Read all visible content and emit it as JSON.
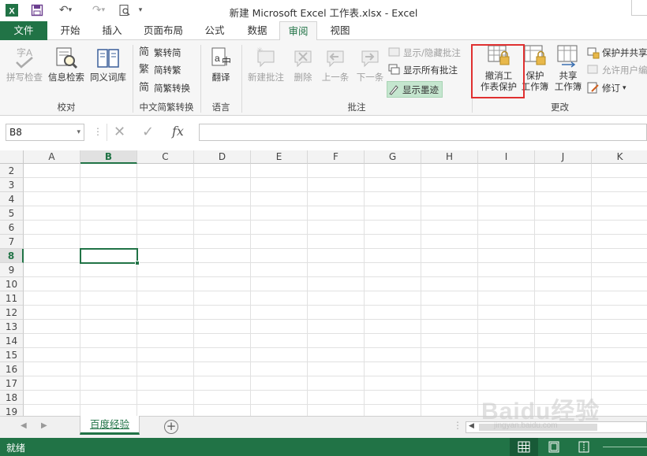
{
  "window": {
    "title": "新建 Microsoft Excel 工作表.xlsx - Excel"
  },
  "tabs": [
    "文件",
    "开始",
    "插入",
    "页面布局",
    "公式",
    "数据",
    "审阅",
    "视图"
  ],
  "active_tab": "审阅",
  "ribbon": {
    "proofing": {
      "group": "校对",
      "spell": "拼写检查",
      "research": "信息检索",
      "thesaurus": "同义词库"
    },
    "chinese": {
      "group": "中文简繁转换",
      "to_simplified": "繁转简",
      "to_traditional": "简转繁",
      "convert": "简繁转换"
    },
    "language": {
      "group": "语言",
      "translate": "翻译"
    },
    "comments": {
      "group": "批注",
      "new": "新建批注",
      "delete": "删除",
      "prev": "上一条",
      "next": "下一条",
      "show_hide": "显示/隐藏批注",
      "show_all": "显示所有批注",
      "show_ink": "显示墨迹"
    },
    "changes": {
      "group": "更改",
      "unprotect_sheet_1": "撤消工",
      "unprotect_sheet_2": "作表保护",
      "protect_wb_1": "保护",
      "protect_wb_2": "工作簿",
      "share_wb_1": "共享",
      "share_wb_2": "工作簿",
      "protect_share": "保护并共享",
      "allow_users": "允许用户编",
      "track": "修订"
    }
  },
  "formula_bar": {
    "name_box": "B8",
    "formula": "",
    "fx": "fx"
  },
  "grid": {
    "columns": [
      "A",
      "B",
      "C",
      "D",
      "E",
      "F",
      "G",
      "H",
      "I",
      "J",
      "K"
    ],
    "rows": [
      "2",
      "3",
      "4",
      "5",
      "6",
      "7",
      "8",
      "9",
      "10",
      "11",
      "12",
      "13",
      "14",
      "15",
      "16",
      "17",
      "18",
      "19"
    ],
    "selected_column": "B",
    "selected_row": "8"
  },
  "sheets": [
    "百度经验"
  ],
  "status": {
    "text": "就绪"
  },
  "watermark": {
    "text": "Baidu经验",
    "sub": "jingyan.baidu.com"
  },
  "colors": {
    "accent": "#217346",
    "highlight_box": "#e03030"
  }
}
